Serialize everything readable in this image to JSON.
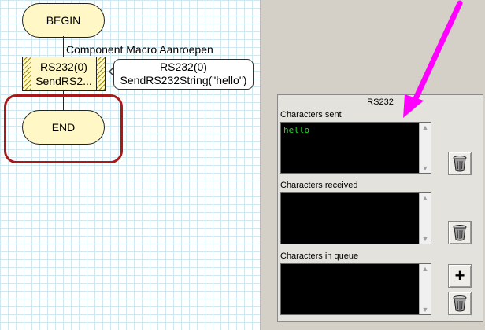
{
  "flowchart": {
    "begin_label": "BEGIN",
    "end_label": "END",
    "macro_caption": "Component Macro Aanroepen",
    "macro_block": {
      "line1": "RS232(0)",
      "line2": "SendRS2..."
    },
    "tooltip": {
      "line1": "RS232(0)",
      "line2": "SendRS232String(\"hello\")"
    }
  },
  "rs232_panel": {
    "title": "RS232",
    "sections": [
      {
        "label": "Characters sent",
        "content": "hello"
      },
      {
        "label": "Characters received",
        "content": ""
      },
      {
        "label": "Characters in queue",
        "content": ""
      }
    ],
    "icons": {
      "clear": "trash-can-icon",
      "add": "plus-icon"
    }
  },
  "colors": {
    "terminal_fill": "#fff8c6",
    "highlight_border": "#a81a1a",
    "annotation_arrow": "#ff00ff",
    "console_text": "#2bd42b"
  }
}
